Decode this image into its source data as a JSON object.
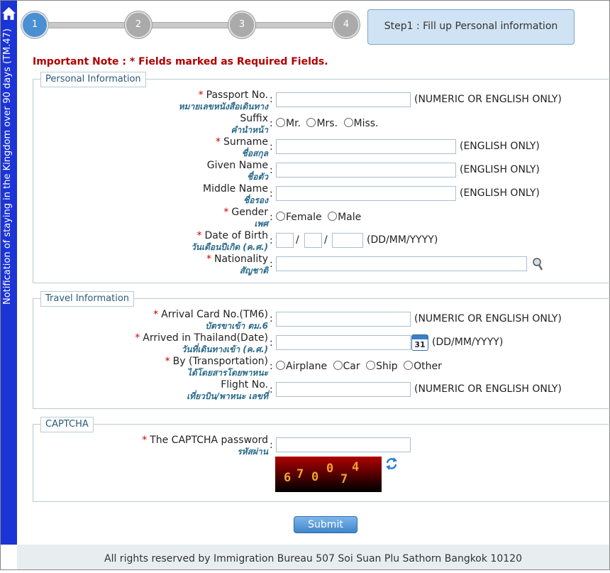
{
  "sidebar": {
    "title": "Notification of staying in the Kingdom over 90 days (TM.47)"
  },
  "steps": {
    "items": [
      "1",
      "2",
      "3",
      "4"
    ],
    "current_title": "Step1 : Fill up Personal information"
  },
  "note": "Important Note : * Fields marked as Required Fields.",
  "personal": {
    "legend": "Personal Information",
    "passport": {
      "label": "Passport No.",
      "thai": "หมายเลขหนังสือเดินทาง",
      "hint": "(NUMERIC OR ENGLISH ONLY)"
    },
    "suffix": {
      "label": "Suffix",
      "thai": "คำนำหน้า",
      "options": [
        "Mr.",
        "Mrs.",
        "Miss."
      ]
    },
    "surname": {
      "label": "Surname",
      "thai": "ชื่อสกุล",
      "hint": "(ENGLISH ONLY)"
    },
    "given": {
      "label": "Given Name",
      "thai": "ชื่อตัว",
      "hint": "(ENGLISH ONLY)"
    },
    "middle": {
      "label": "Middle Name",
      "thai": "ชื่อรอง",
      "hint": "(ENGLISH ONLY)"
    },
    "gender": {
      "label": "Gender",
      "thai": "เพศ",
      "options": [
        "Female",
        "Male"
      ]
    },
    "dob": {
      "label": "Date of Birth",
      "thai": "วันเดือนปีเกิด (ค.ศ.)",
      "sep": "/",
      "hint": "(DD/MM/YYYY)"
    },
    "nationality": {
      "label": "Nationality",
      "thai": "สัญชาติ"
    }
  },
  "travel": {
    "legend": "Travel Information",
    "arrival_card": {
      "label": "Arrival Card No.(TM6)",
      "thai": "บัตรขาเข้า ตม.6",
      "hint": "(NUMERIC OR ENGLISH ONLY)"
    },
    "arrived": {
      "label": "Arrived in Thailand(Date)",
      "thai": "วันที่เดินทางเข้า (ค.ศ.)",
      "hint": "(DD/MM/YYYY)",
      "calendar_day": "31"
    },
    "transport": {
      "label": "By (Transportation)",
      "thai": "ได้โดยสารโดยพาหนะ",
      "options": [
        "Airplane",
        "Car",
        "Ship",
        "Other"
      ]
    },
    "flight": {
      "label": "Flight No.",
      "thai": "เที่ยวบิน/พาหนะ เลขที่",
      "hint": "(NUMERIC OR ENGLISH ONLY)"
    }
  },
  "captcha": {
    "legend": "CAPTCHA",
    "label": "The CAPTCHA password",
    "thai": "รหัสผ่าน",
    "chars": [
      "6",
      "7",
      "0",
      "0",
      "7",
      "4"
    ]
  },
  "submit_label": "Submit",
  "footer": "All rights reserved by Immigration Bureau 507 Soi Suan Plu Sathorn Bangkok 10120",
  "colors": {
    "sidebar": "#1b34d6",
    "required": "#c00000",
    "thai_label": "#2c6b8c",
    "step_active": "#4a8fd1"
  }
}
